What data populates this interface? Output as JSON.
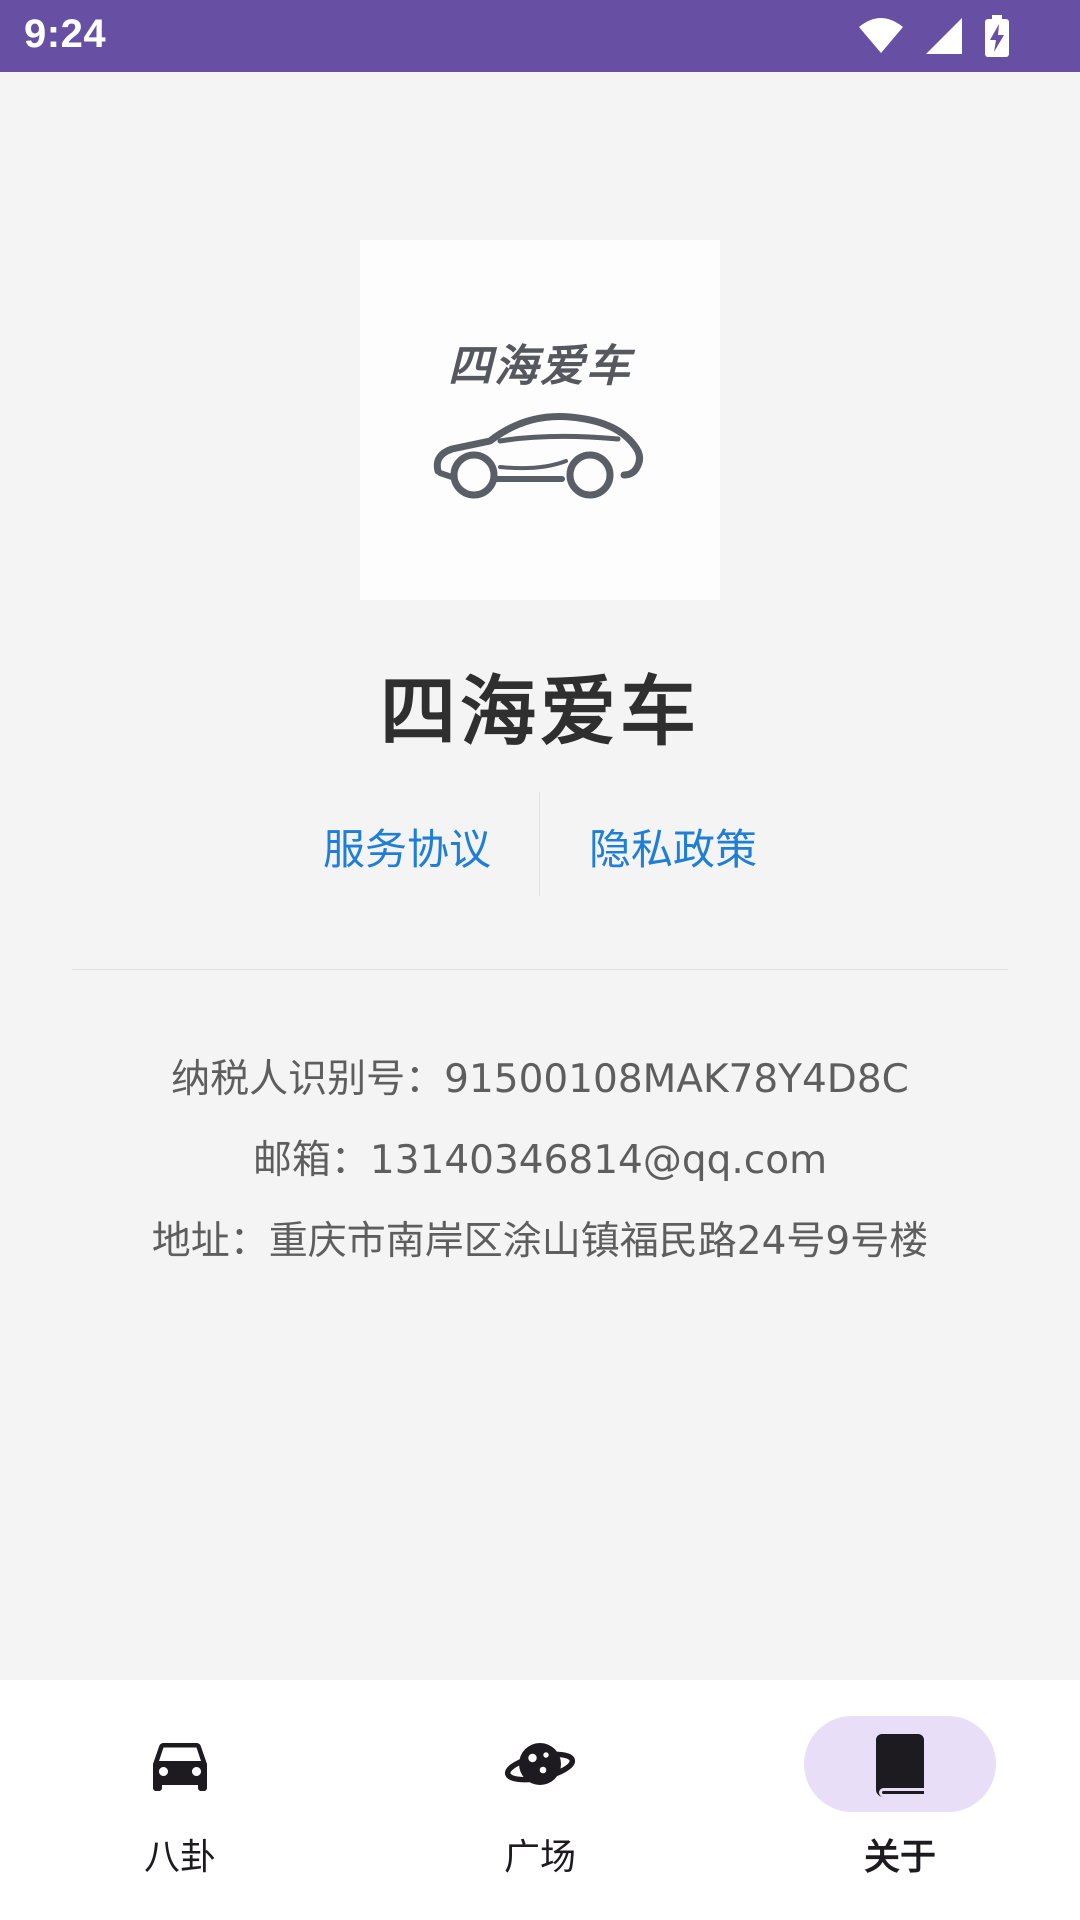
{
  "status_bar": {
    "time": "9:24",
    "icons": [
      "wifi-icon",
      "cell-signal-icon",
      "battery-charging-icon"
    ]
  },
  "about": {
    "logo_text": "四海爱车",
    "app_name": "四海爱车",
    "links": {
      "service": "服务协议",
      "privacy": "隐私政策"
    },
    "info": {
      "tax_id": "纳税人识别号：91500108MAK78Y4D8C",
      "email": "邮箱：13140346814@qq.com",
      "address": "地址：重庆市南岸区涂山镇福民路24号9号楼"
    }
  },
  "bottom_nav": {
    "items": [
      {
        "label": "八卦",
        "icon": "car-icon",
        "active": false
      },
      {
        "label": "广场",
        "icon": "planet-icon",
        "active": false
      },
      {
        "label": "关于",
        "icon": "book-icon",
        "active": true
      }
    ]
  },
  "colors": {
    "status_bar": "#6750a4",
    "link": "#1f7fd6",
    "nav_active_indicator": "#e8def8",
    "background": "#f4f4f4"
  }
}
